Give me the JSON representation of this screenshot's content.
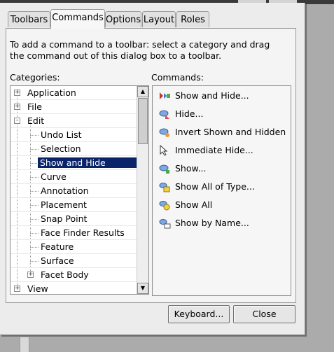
{
  "tabs": [
    "Toolbars",
    "Commands",
    "Options",
    "Layout",
    "Roles"
  ],
  "active_tab": "Commands",
  "instructions": {
    "line1": "To add a command to a toolbar: select a category and drag",
    "line2": "the command out of this dialog box to a toolbar."
  },
  "categories_label": "Categories:",
  "commands_label": "Commands:",
  "categories": [
    {
      "label": "Application",
      "expander": "+"
    },
    {
      "label": "File",
      "expander": "+"
    },
    {
      "label": "Edit",
      "expander": "-"
    },
    {
      "label": "Undo List"
    },
    {
      "label": "Selection"
    },
    {
      "label": "Show and Hide",
      "selected": true
    },
    {
      "label": "Curve"
    },
    {
      "label": "Annotation"
    },
    {
      "label": "Placement"
    },
    {
      "label": "Snap Point"
    },
    {
      "label": "Face Finder Results"
    },
    {
      "label": "Feature"
    },
    {
      "label": "Surface"
    },
    {
      "label": "Facet Body",
      "expander": "+"
    },
    {
      "label": "View",
      "expander": "+"
    }
  ],
  "commands": [
    {
      "label": "Show and Hide...",
      "icon": "show-and-hide-icon"
    },
    {
      "label": "Hide...",
      "icon": "hide-icon"
    },
    {
      "label": "Invert Shown and Hidden",
      "icon": "invert-shown-hidden-icon"
    },
    {
      "label": "Immediate Hide...",
      "icon": "immediate-hide-icon"
    },
    {
      "label": "Show...",
      "icon": "show-icon"
    },
    {
      "label": "Show All of Type...",
      "icon": "show-all-of-type-icon"
    },
    {
      "label": "Show All",
      "icon": "show-all-icon"
    },
    {
      "label": "Show by Name...",
      "icon": "show-by-name-icon"
    }
  ],
  "buttons": {
    "keyboard": "Keyboard...",
    "close": "Close"
  }
}
